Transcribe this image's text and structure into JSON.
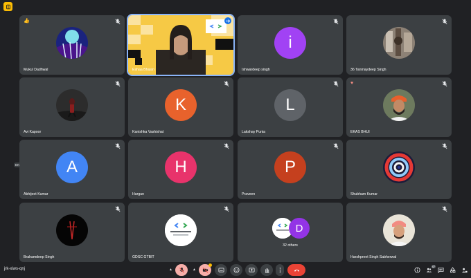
{
  "meeting": {
    "code": "jrk-xiws-qnj",
    "others_count_label": "32 others",
    "participant_badge": "47"
  },
  "floating_reaction": {
    "emoji": "♥",
    "name": "EKAS BHUI"
  },
  "participants": [
    {
      "name": "Mukul Dadhwal",
      "avatar": "photo",
      "reaction": "👍"
    },
    {
      "name": "Eshaa Bhasin",
      "avatar": "video"
    },
    {
      "name": "Ishwardeep singh",
      "avatar": "letter",
      "letter": "i",
      "color": "#a142f4"
    },
    {
      "name": "36 Tanmaydeep Singh",
      "avatar": "photo"
    },
    {
      "name": "Avi Kapoor",
      "avatar": "photo"
    },
    {
      "name": "Kanishka Vashishat",
      "avatar": "letter",
      "letter": "K",
      "color": "#e8622c"
    },
    {
      "name": "Lakshay Punia",
      "avatar": "letter",
      "letter": "L",
      "color": "#5f6368"
    },
    {
      "name": "EKAS BHUI",
      "avatar": "photo",
      "reaction": "♥"
    },
    {
      "name": "Abhijeet Kumar",
      "avatar": "letter",
      "letter": "A",
      "color": "#4285f4"
    },
    {
      "name": "Hargun",
      "avatar": "letter",
      "letter": "H",
      "color": "#e8336b"
    },
    {
      "name": "Praveen",
      "avatar": "letter",
      "letter": "P",
      "color": "#c5401e"
    },
    {
      "name": "Shubham Kumar",
      "avatar": "photo"
    },
    {
      "name": "Brahamdeep Singh",
      "avatar": "photo"
    },
    {
      "name": "GDSC GTBIT",
      "avatar": "logo"
    },
    {
      "name": "",
      "avatar": "overflow",
      "letter": "D",
      "color": "#9334e6"
    },
    {
      "name": "Harshpreet Singh Sabherwal",
      "avatar": "photo"
    }
  ],
  "controls": [
    {
      "name": "microphone",
      "state": "off"
    },
    {
      "name": "camera",
      "state": "off"
    },
    {
      "name": "captions",
      "state": "off"
    },
    {
      "name": "reactions",
      "state": "off"
    },
    {
      "name": "present",
      "state": "off"
    },
    {
      "name": "raise-hand",
      "state": "off"
    },
    {
      "name": "more-options",
      "state": "off"
    },
    {
      "name": "leave-call",
      "state": "danger"
    }
  ],
  "right_controls": [
    "info",
    "people",
    "chat",
    "activities",
    "host-controls"
  ],
  "colors": {
    "background": "#202124",
    "tile": "#3c4043",
    "active_outline": "#8ab4f8",
    "leave": "#ea4335",
    "muted": "#f6aea9"
  }
}
